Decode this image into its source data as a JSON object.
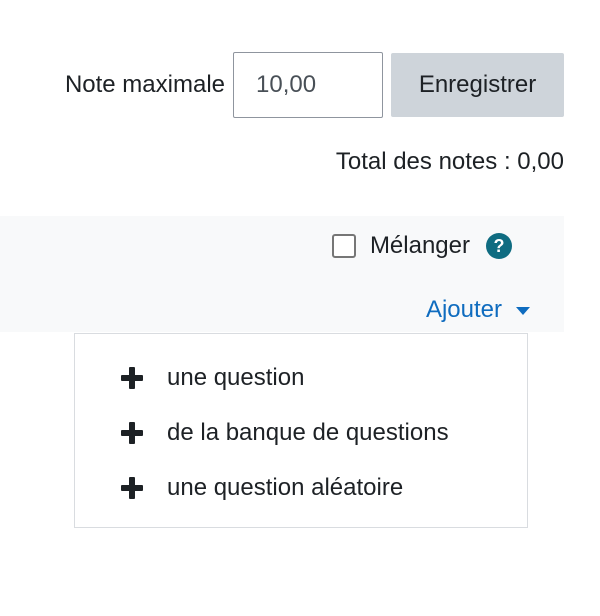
{
  "grading": {
    "max_grade_label": "Note maximale",
    "max_grade_value": "10,00",
    "save_label": "Enregistrer",
    "total_label": "Total des notes : 0,00"
  },
  "section": {
    "shuffle_label": "Mélanger",
    "help_icon": "question-circle-icon",
    "add_label": "Ajouter"
  },
  "add_menu": {
    "items": [
      {
        "label": "une question",
        "icon": "plus-icon"
      },
      {
        "label": "de la banque de questions",
        "icon": "plus-icon"
      },
      {
        "label": "une question aléatoire",
        "icon": "plus-icon"
      }
    ]
  },
  "colors": {
    "link": "#0f6cbf",
    "help_icon_bg": "#0f6c81",
    "button_bg": "#ced4da",
    "section_bg": "#f8f9fa"
  }
}
